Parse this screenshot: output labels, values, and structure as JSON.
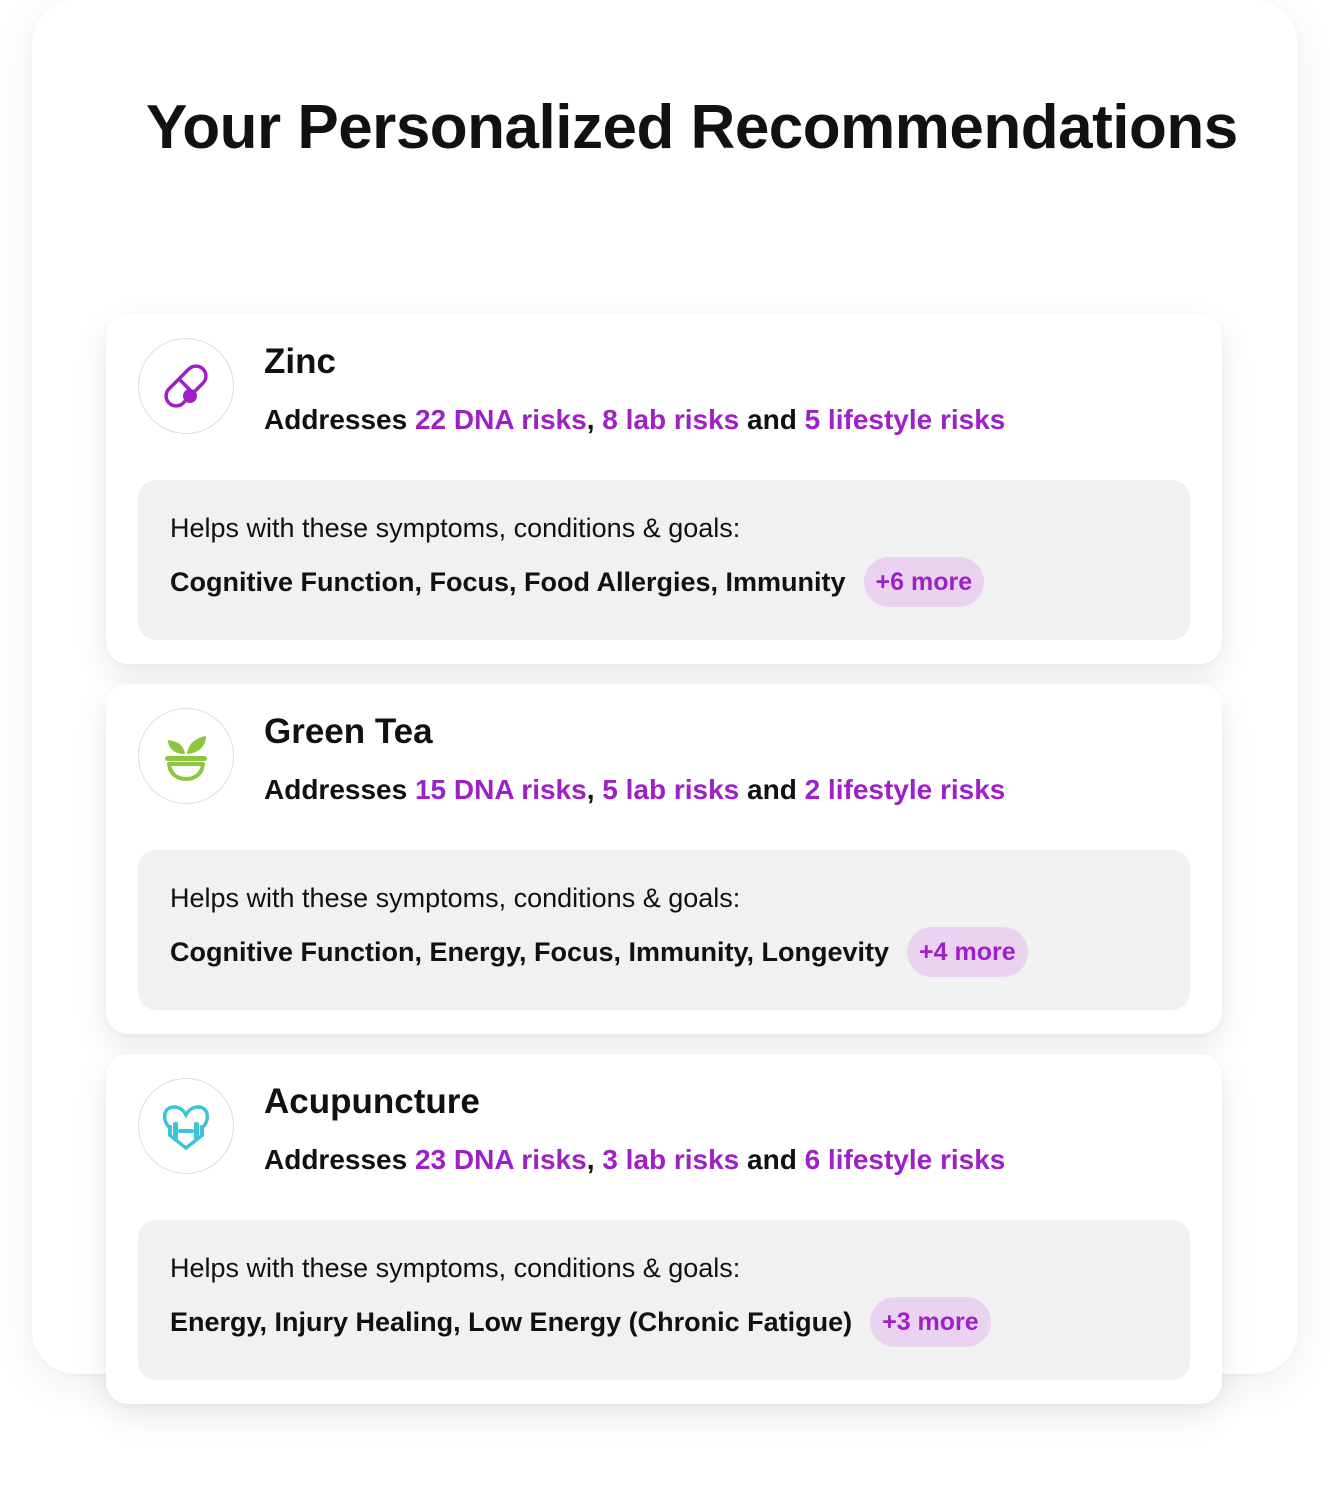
{
  "page_title": "Your Personalized Recommendations",
  "colors": {
    "accent": "#a020c8",
    "pill_background": "#ead3f0",
    "help_background": "#f1f1f2",
    "zinc_icon": "#a020c8",
    "green_tea_icon": "#8cc63f",
    "acupuncture_icon": "#3cc4d8"
  },
  "cards": [
    {
      "name": "Zinc",
      "icon": "pill-icon",
      "addresses_prefix": "Addresses",
      "dna_risks": "22 DNA risks",
      "sep": ",",
      "lab_risks": "8 lab risks",
      "and": "and",
      "lifestyle_risks": "5 lifestyle risks",
      "help_heading": "Helps with these symptoms, conditions & goals:",
      "help_list": "Cognitive Function, Focus, Food Allergies, Immunity",
      "more": "+6 more"
    },
    {
      "name": "Green Tea",
      "icon": "herb-bowl-icon",
      "addresses_prefix": "Addresses",
      "dna_risks": "15 DNA risks",
      "sep": ",",
      "lab_risks": "5 lab risks",
      "and": "and",
      "lifestyle_risks": "2 lifestyle risks",
      "help_heading": "Helps with these symptoms, conditions & goals:",
      "help_list": "Cognitive Function, Energy, Focus, Immunity, Longevity",
      "more": "+4 more"
    },
    {
      "name": "Acupuncture",
      "icon": "heart-dumbbell-icon",
      "addresses_prefix": "Addresses",
      "dna_risks": "23 DNA risks",
      "sep": ",",
      "lab_risks": "3 lab risks",
      "and": "and",
      "lifestyle_risks": "6 lifestyle risks",
      "help_heading": "Helps with these symptoms, conditions & goals:",
      "help_list": "Energy, Injury Healing, Low Energy (Chronic Fatigue)",
      "more": "+3 more"
    }
  ]
}
